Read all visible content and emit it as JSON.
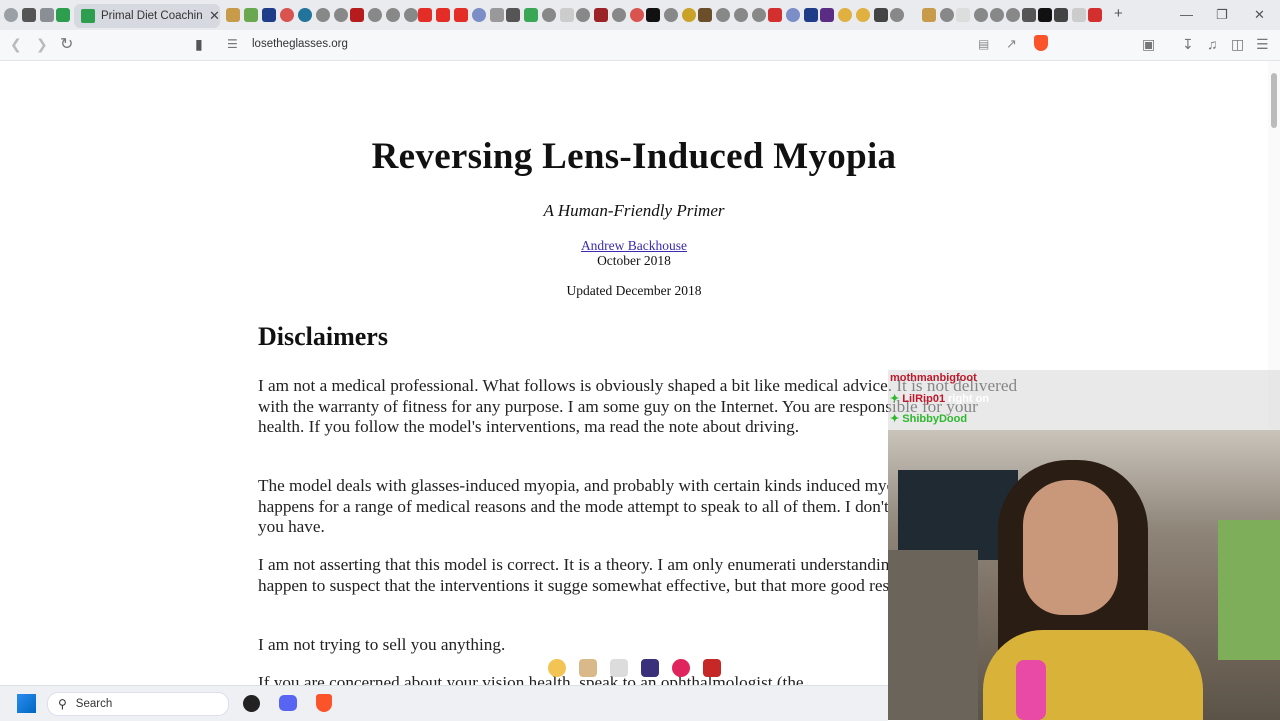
{
  "browser": {
    "active_tab_title": "Primal Diet Coaching",
    "url": "losetheglasses.org",
    "close_glyph": "✕",
    "new_tab_glyph": "+"
  },
  "article": {
    "title": "Reversing Lens-Induced Myopia",
    "subtitle": "A Human-Friendly Primer",
    "author": "Andrew Backhouse",
    "date": "October 2018",
    "updated": "Updated December 2018",
    "section_heading": "Disclaimers",
    "paragraphs": [
      "I am not a medical professional. What follows is obviously shaped a bit like medical advice. It is not delivered with the warranty of fitness for any purpose. I am some guy on the Internet. You are responsible for your health. If you follow the model's interventions, ma read the note about driving.",
      "The model deals with glasses-induced myopia, and probably with certain kinds induced myopia. Myopia happens for a range of medical reasons and the mode attempt to speak to all of them. I don't know what kind you have.",
      "I am not asserting that this model is correct. It is a theory. I am only enumerati understanding of it in detail. I happen to suspect that the interventions it sugge somewhat effective, but that more good research is necessary.",
      "I am not trying to sell you anything.",
      "If you are concerned about your vision health, speak to an ophthalmologist (the"
    ]
  },
  "chat": [
    {
      "user": "mothmanbigfoot",
      "message": "",
      "color": "#c0182a"
    },
    {
      "user": "LilRip01",
      "message": "right on",
      "color": "#c0182a"
    },
    {
      "user": "ShibbyDood",
      "message": "",
      "color": "#2eb82e"
    }
  ],
  "taskbar": {
    "search_placeholder": "Search"
  }
}
